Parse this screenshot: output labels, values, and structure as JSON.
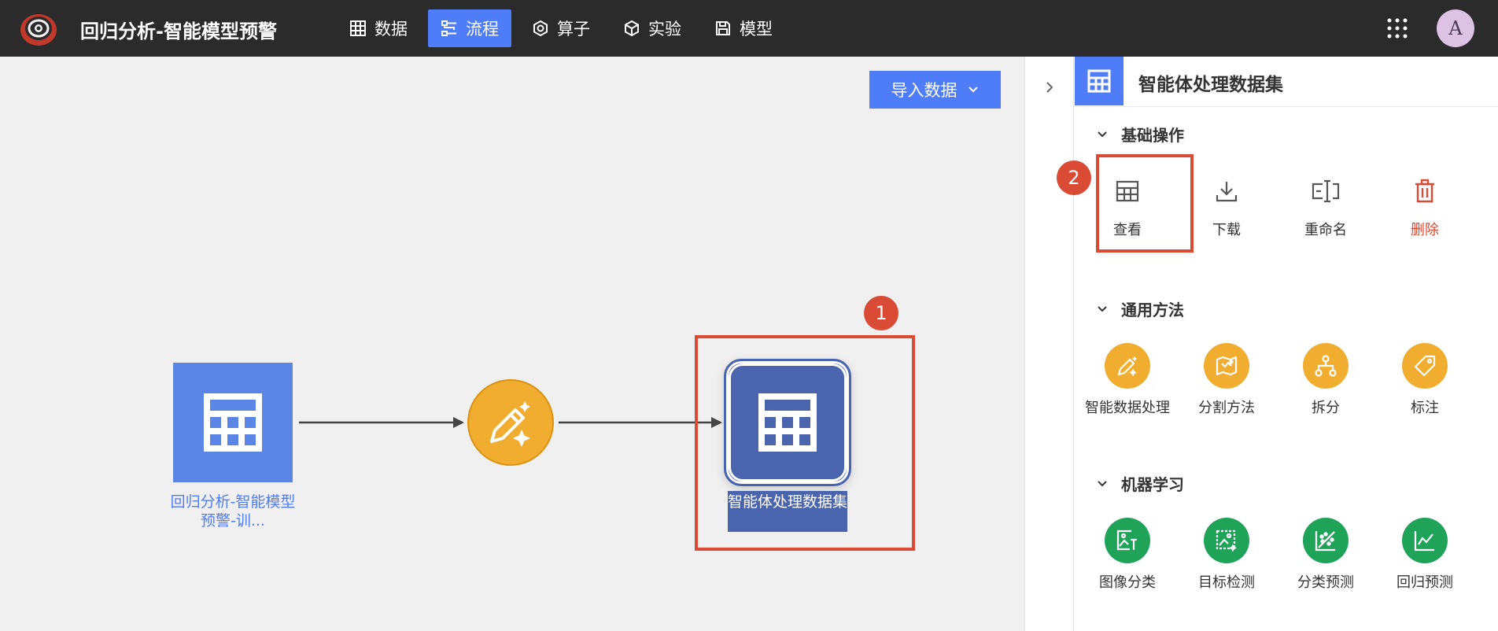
{
  "app": {
    "title": "回归分析-智能模型预警",
    "avatar_letter": "A"
  },
  "nav": [
    {
      "label": "数据",
      "icon": "table-icon"
    },
    {
      "label": "流程",
      "icon": "flow-icon",
      "active": true
    },
    {
      "label": "算子",
      "icon": "hexagon-icon"
    },
    {
      "label": "实验",
      "icon": "cube-icon"
    },
    {
      "label": "模型",
      "icon": "save-icon"
    }
  ],
  "canvas": {
    "import_button": "导入数据",
    "source_node_label": "回归分析-智能模型预警-训...",
    "output_node_label": "智能体处理数据集"
  },
  "badges": {
    "first": "1",
    "second": "2"
  },
  "panel": {
    "title": "智能体处理数据集",
    "sections": {
      "basic": {
        "title": "基础操作",
        "items": [
          "查看",
          "下载",
          "重命名",
          "删除"
        ]
      },
      "general": {
        "title": "通用方法",
        "items": [
          "智能数据处理",
          "分割方法",
          "拆分",
          "标注"
        ]
      },
      "ml": {
        "title": "机器学习",
        "items": [
          "图像分类",
          "目标检测",
          "分类预测",
          "回归预测"
        ]
      }
    }
  },
  "colors": {
    "accent": "#4f7cf7",
    "node_dark": "#4a65ad",
    "operator": "#f0ad2f",
    "ml": "#1fa359",
    "danger": "#d94b35"
  }
}
